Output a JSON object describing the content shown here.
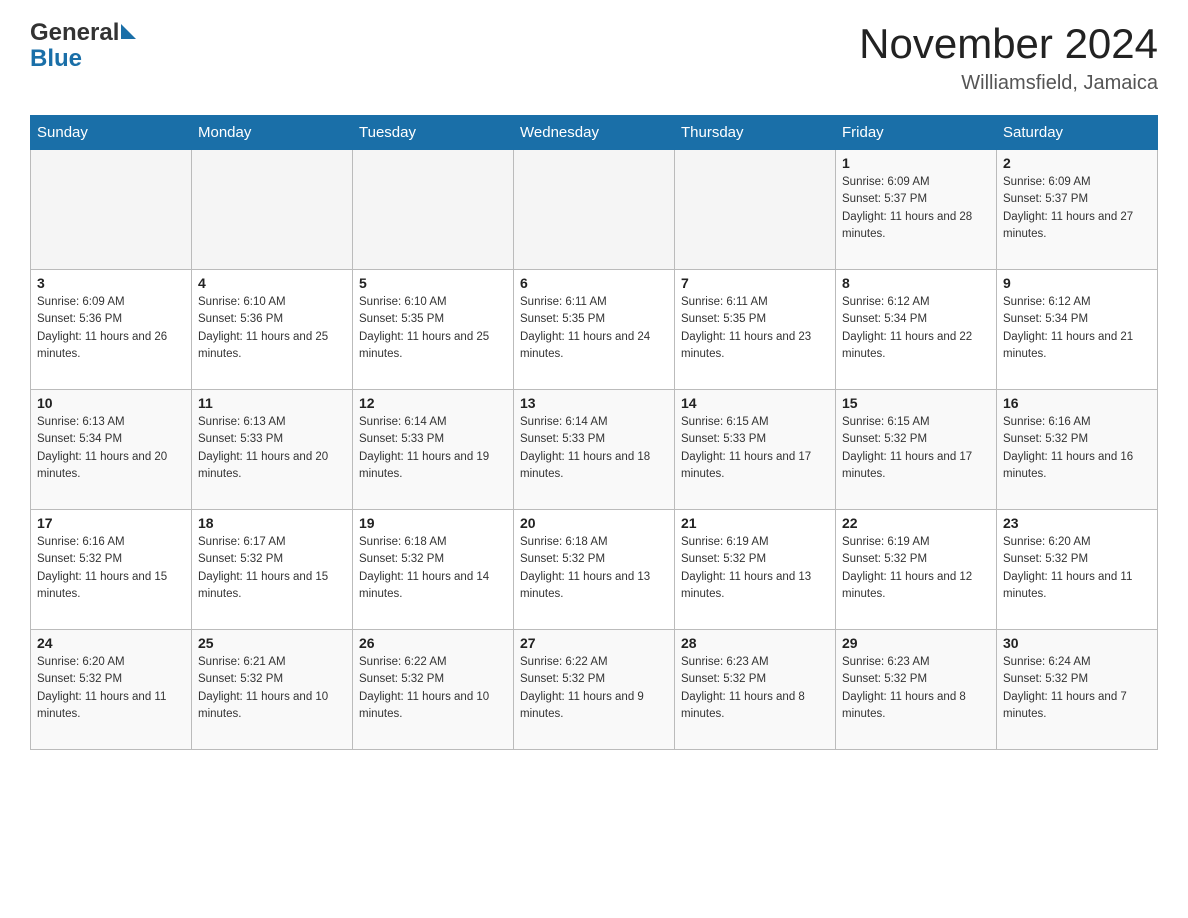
{
  "header": {
    "logo_general": "General",
    "logo_blue": "Blue",
    "month_year": "November 2024",
    "location": "Williamsfield, Jamaica"
  },
  "days_of_week": [
    "Sunday",
    "Monday",
    "Tuesday",
    "Wednesday",
    "Thursday",
    "Friday",
    "Saturday"
  ],
  "weeks": [
    {
      "days": [
        {
          "num": "",
          "info": ""
        },
        {
          "num": "",
          "info": ""
        },
        {
          "num": "",
          "info": ""
        },
        {
          "num": "",
          "info": ""
        },
        {
          "num": "",
          "info": ""
        },
        {
          "num": "1",
          "info": "Sunrise: 6:09 AM\nSunset: 5:37 PM\nDaylight: 11 hours and 28 minutes."
        },
        {
          "num": "2",
          "info": "Sunrise: 6:09 AM\nSunset: 5:37 PM\nDaylight: 11 hours and 27 minutes."
        }
      ]
    },
    {
      "days": [
        {
          "num": "3",
          "info": "Sunrise: 6:09 AM\nSunset: 5:36 PM\nDaylight: 11 hours and 26 minutes."
        },
        {
          "num": "4",
          "info": "Sunrise: 6:10 AM\nSunset: 5:36 PM\nDaylight: 11 hours and 25 minutes."
        },
        {
          "num": "5",
          "info": "Sunrise: 6:10 AM\nSunset: 5:35 PM\nDaylight: 11 hours and 25 minutes."
        },
        {
          "num": "6",
          "info": "Sunrise: 6:11 AM\nSunset: 5:35 PM\nDaylight: 11 hours and 24 minutes."
        },
        {
          "num": "7",
          "info": "Sunrise: 6:11 AM\nSunset: 5:35 PM\nDaylight: 11 hours and 23 minutes."
        },
        {
          "num": "8",
          "info": "Sunrise: 6:12 AM\nSunset: 5:34 PM\nDaylight: 11 hours and 22 minutes."
        },
        {
          "num": "9",
          "info": "Sunrise: 6:12 AM\nSunset: 5:34 PM\nDaylight: 11 hours and 21 minutes."
        }
      ]
    },
    {
      "days": [
        {
          "num": "10",
          "info": "Sunrise: 6:13 AM\nSunset: 5:34 PM\nDaylight: 11 hours and 20 minutes."
        },
        {
          "num": "11",
          "info": "Sunrise: 6:13 AM\nSunset: 5:33 PM\nDaylight: 11 hours and 20 minutes."
        },
        {
          "num": "12",
          "info": "Sunrise: 6:14 AM\nSunset: 5:33 PM\nDaylight: 11 hours and 19 minutes."
        },
        {
          "num": "13",
          "info": "Sunrise: 6:14 AM\nSunset: 5:33 PM\nDaylight: 11 hours and 18 minutes."
        },
        {
          "num": "14",
          "info": "Sunrise: 6:15 AM\nSunset: 5:33 PM\nDaylight: 11 hours and 17 minutes."
        },
        {
          "num": "15",
          "info": "Sunrise: 6:15 AM\nSunset: 5:32 PM\nDaylight: 11 hours and 17 minutes."
        },
        {
          "num": "16",
          "info": "Sunrise: 6:16 AM\nSunset: 5:32 PM\nDaylight: 11 hours and 16 minutes."
        }
      ]
    },
    {
      "days": [
        {
          "num": "17",
          "info": "Sunrise: 6:16 AM\nSunset: 5:32 PM\nDaylight: 11 hours and 15 minutes."
        },
        {
          "num": "18",
          "info": "Sunrise: 6:17 AM\nSunset: 5:32 PM\nDaylight: 11 hours and 15 minutes."
        },
        {
          "num": "19",
          "info": "Sunrise: 6:18 AM\nSunset: 5:32 PM\nDaylight: 11 hours and 14 minutes."
        },
        {
          "num": "20",
          "info": "Sunrise: 6:18 AM\nSunset: 5:32 PM\nDaylight: 11 hours and 13 minutes."
        },
        {
          "num": "21",
          "info": "Sunrise: 6:19 AM\nSunset: 5:32 PM\nDaylight: 11 hours and 13 minutes."
        },
        {
          "num": "22",
          "info": "Sunrise: 6:19 AM\nSunset: 5:32 PM\nDaylight: 11 hours and 12 minutes."
        },
        {
          "num": "23",
          "info": "Sunrise: 6:20 AM\nSunset: 5:32 PM\nDaylight: 11 hours and 11 minutes."
        }
      ]
    },
    {
      "days": [
        {
          "num": "24",
          "info": "Sunrise: 6:20 AM\nSunset: 5:32 PM\nDaylight: 11 hours and 11 minutes."
        },
        {
          "num": "25",
          "info": "Sunrise: 6:21 AM\nSunset: 5:32 PM\nDaylight: 11 hours and 10 minutes."
        },
        {
          "num": "26",
          "info": "Sunrise: 6:22 AM\nSunset: 5:32 PM\nDaylight: 11 hours and 10 minutes."
        },
        {
          "num": "27",
          "info": "Sunrise: 6:22 AM\nSunset: 5:32 PM\nDaylight: 11 hours and 9 minutes."
        },
        {
          "num": "28",
          "info": "Sunrise: 6:23 AM\nSunset: 5:32 PM\nDaylight: 11 hours and 8 minutes."
        },
        {
          "num": "29",
          "info": "Sunrise: 6:23 AM\nSunset: 5:32 PM\nDaylight: 11 hours and 8 minutes."
        },
        {
          "num": "30",
          "info": "Sunrise: 6:24 AM\nSunset: 5:32 PM\nDaylight: 11 hours and 7 minutes."
        }
      ]
    }
  ]
}
